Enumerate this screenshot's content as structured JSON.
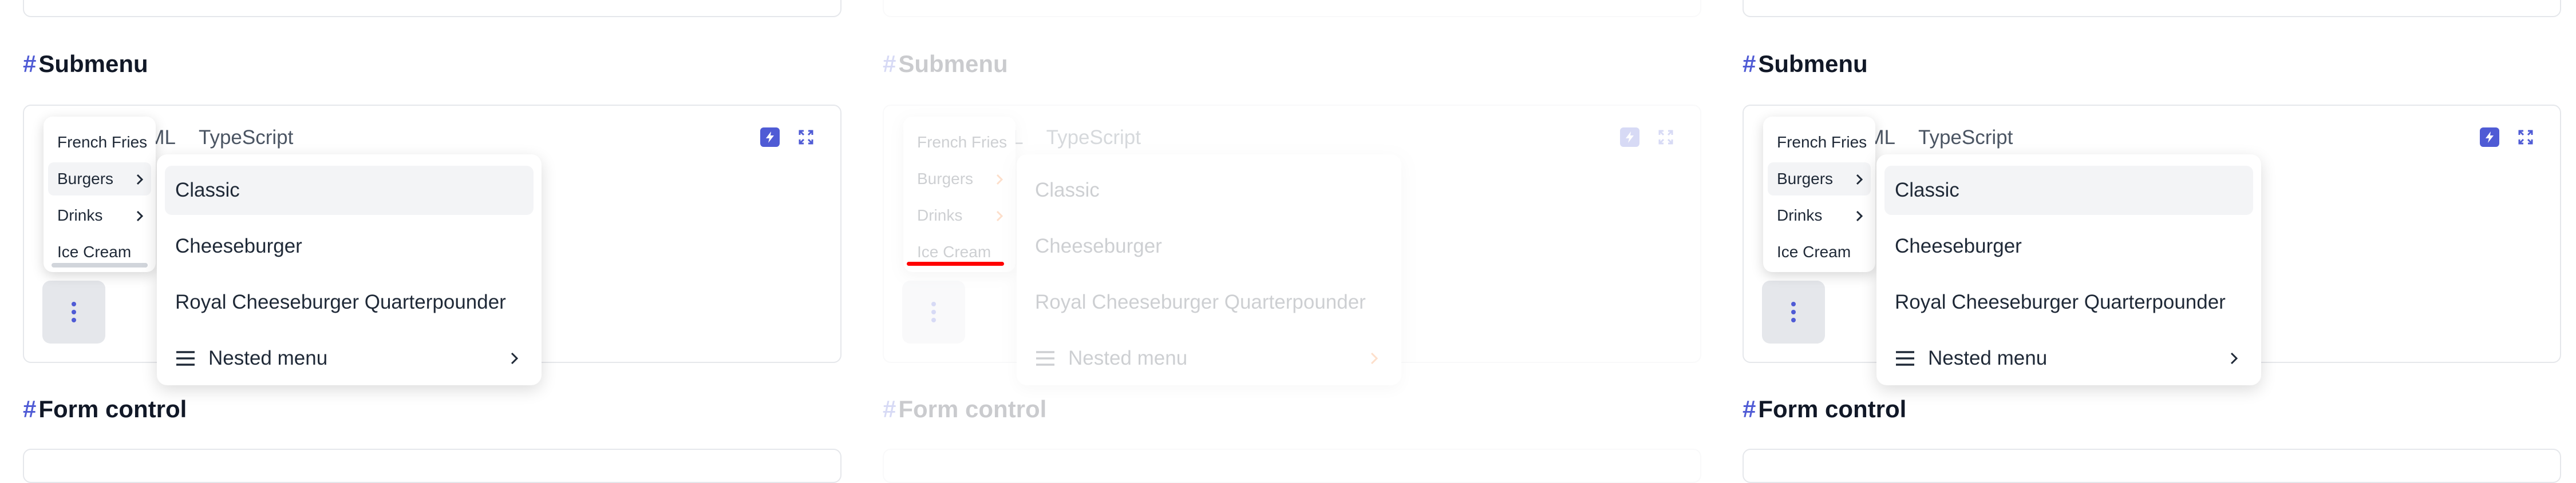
{
  "sections": {
    "submenu_heading": "Submenu",
    "form_control_heading": "Form control",
    "hash": "#"
  },
  "tabs": [
    "HTML",
    "TypeScript"
  ],
  "visible_tab_fragments": {
    "html_visible": "TML",
    "html_visible_p2": "ML",
    "typescript": "TypeScript"
  },
  "submenu": {
    "items": [
      "French Fries",
      "Burgers",
      "Drinks",
      "Ice Cream"
    ],
    "active_item": "Burgers"
  },
  "nested_menu": {
    "items": [
      "Classic",
      "Cheeseburger",
      "Royal Cheeseburger Quarterpounder"
    ],
    "nested_label": "Nested menu",
    "active_item": "Classic"
  },
  "icons": {
    "toolbar": [
      "bolt-icon",
      "expand-icon"
    ],
    "trigger": "more-vertical-icon",
    "nested": "hamburger-icon"
  },
  "colors": {
    "accent": "#4f5bd5",
    "highlight_chevron": "#f97316",
    "focus_underline": "#ff0000"
  }
}
